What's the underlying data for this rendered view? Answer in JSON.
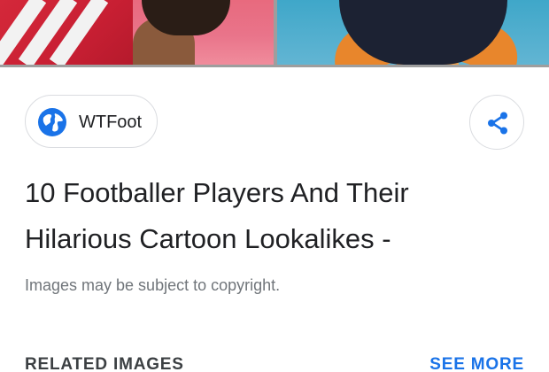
{
  "source": {
    "name": "WTFoot",
    "icon": "globe-icon",
    "icon_color": "#1a73e8"
  },
  "share": {
    "icon": "share-icon",
    "icon_color": "#1a73e8"
  },
  "result": {
    "title_line1": "10 Footballer Players And Their",
    "title_line2": "Hilarious Cartoon Lookalikes -",
    "copyright_note": "Images may be subject to copyright."
  },
  "related": {
    "heading": "RELATED IMAGES",
    "see_more_label": "SEE MORE"
  },
  "colors": {
    "accent": "#1a73e8",
    "text_primary": "#202124",
    "text_secondary": "#70757a",
    "chip_border": "#dadce0"
  }
}
